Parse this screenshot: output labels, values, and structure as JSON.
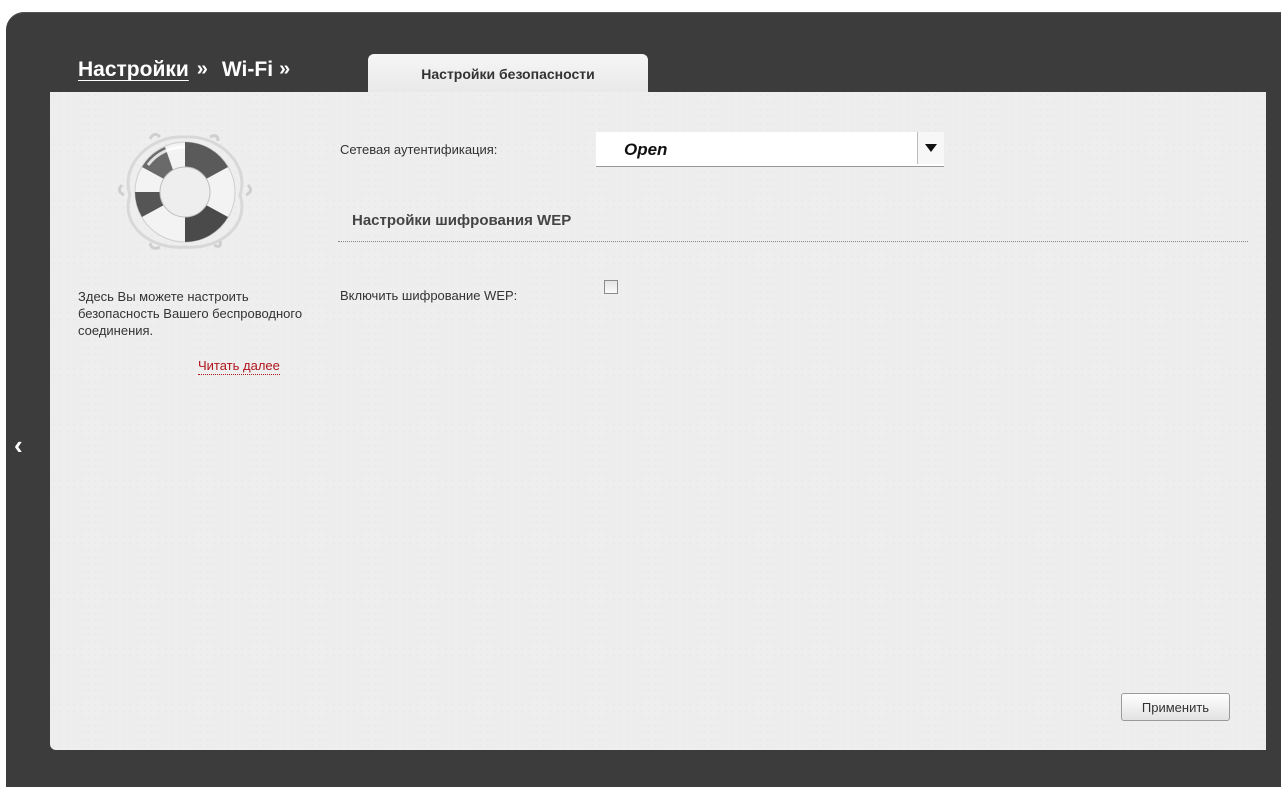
{
  "breadcrumb": {
    "level1": "Настройки",
    "sep1": "»",
    "level2": "Wi-Fi",
    "sep2": "»"
  },
  "tab": {
    "label": "Настройки безопасности"
  },
  "sidebar": {
    "help_text": "Здесь Вы можете настроить безопасность Вашего беспроводного соединения.",
    "read_more": "Читать далее",
    "icon": "lifebuoy-icon",
    "back_arrow": "‹"
  },
  "form": {
    "auth_label": "Сетевая аутентификация:",
    "auth_value": "Open",
    "wep_section_title": "Настройки шифрования WEP",
    "wep_enable_label": "Включить шифрование WEP:",
    "wep_enabled": false
  },
  "buttons": {
    "apply": "Применить"
  },
  "colors": {
    "frame": "#3c3c3c",
    "panel": "#eeeeee",
    "link_red": "#b0151c"
  }
}
